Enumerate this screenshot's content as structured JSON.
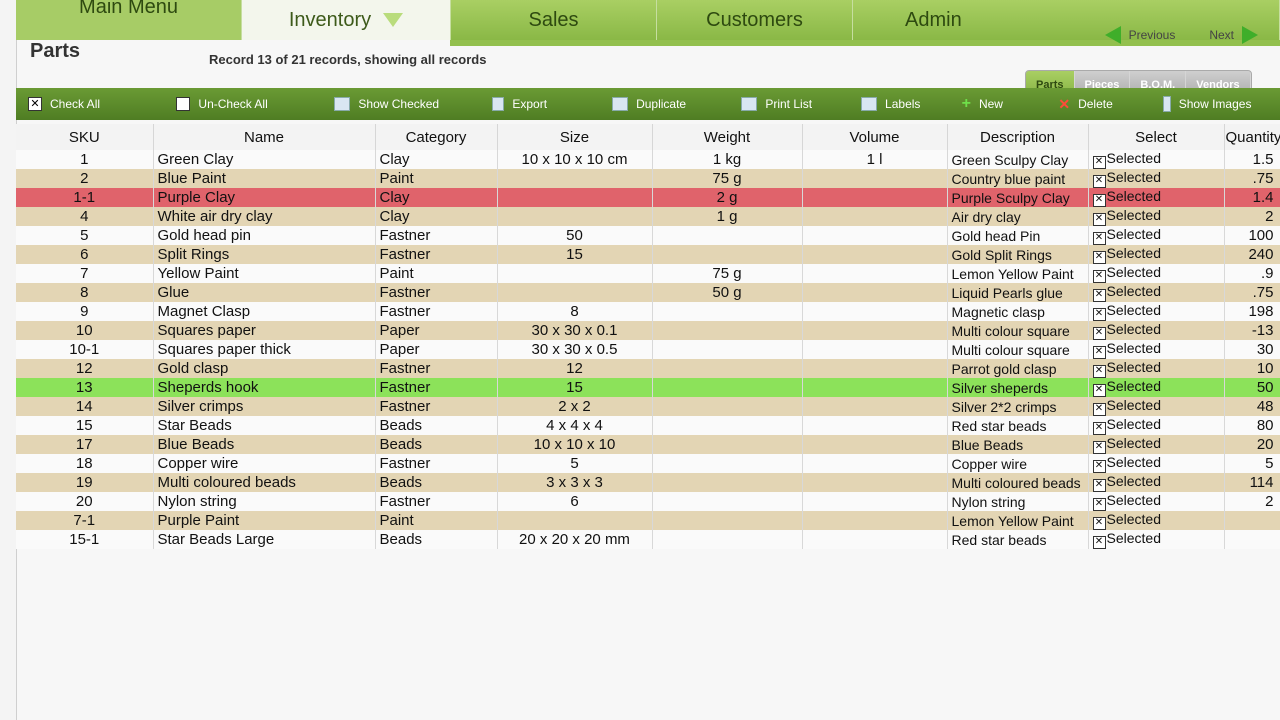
{
  "tabs": [
    {
      "label": "Main Menu"
    },
    {
      "label": "Inventory"
    },
    {
      "label": "Sales"
    },
    {
      "label": "Customers"
    },
    {
      "label": "Admin"
    }
  ],
  "nav": {
    "previous": "Previous",
    "next": "Next"
  },
  "page_title": "Parts",
  "record_info": "Record 13 of 21 records, showing all records",
  "segmented": [
    "Parts",
    "Pieces",
    "B.O.M.",
    "Vendors"
  ],
  "toolbar": {
    "check_all": "Check All",
    "uncheck_all": "Un-Check All",
    "show_checked": "Show Checked",
    "export": "Export",
    "duplicate": "Duplicate",
    "print_list": "Print List",
    "labels": "Labels",
    "new": "New",
    "delete": "Delete",
    "show_images": "Show Images"
  },
  "columns": [
    "SKU",
    "Name",
    "Category",
    "Size",
    "Weight",
    "Volume",
    "Description",
    "Select",
    "Quantity"
  ],
  "rows": [
    {
      "sku": "1",
      "name": "Green Clay",
      "category": "Clay",
      "size": "10 x 10 x 10 cm",
      "weight": "1 kg",
      "volume": "1 l",
      "description": "Green Sculpy Clay",
      "select": "Selected",
      "quantity": "1.5"
    },
    {
      "sku": "2",
      "name": "Blue Paint",
      "category": "Paint",
      "size": "",
      "weight": "75 g",
      "volume": "",
      "description": "Country blue paint",
      "select": "Selected",
      "quantity": ".75"
    },
    {
      "sku": "1-1",
      "name": "Purple Clay",
      "category": "Clay",
      "size": "",
      "weight": "2 g",
      "volume": "",
      "description": "Purple Sculpy Clay",
      "select": "Selected",
      "quantity": "1.4"
    },
    {
      "sku": "4",
      "name": "White air dry clay",
      "category": "Clay",
      "size": "",
      "weight": "1 g",
      "volume": "",
      "description": "Air dry clay",
      "select": "Selected",
      "quantity": "2"
    },
    {
      "sku": "5",
      "name": "Gold head pin",
      "category": "Fastner",
      "size": "50",
      "weight": "",
      "volume": "",
      "description": "Gold head Pin",
      "select": "Selected",
      "quantity": "100"
    },
    {
      "sku": "6",
      "name": "Split Rings",
      "category": "Fastner",
      "size": "15",
      "weight": "",
      "volume": "",
      "description": "Gold Split Rings",
      "select": "Selected",
      "quantity": "240"
    },
    {
      "sku": "7",
      "name": "Yellow Paint",
      "category": "Paint",
      "size": "",
      "weight": "75 g",
      "volume": "",
      "description": "Lemon Yellow Paint",
      "select": "Selected",
      "quantity": ".9"
    },
    {
      "sku": "8",
      "name": "Glue",
      "category": "Fastner",
      "size": "",
      "weight": "50 g",
      "volume": "",
      "description": "Liquid Pearls glue",
      "select": "Selected",
      "quantity": ".75"
    },
    {
      "sku": "9",
      "name": "Magnet Clasp",
      "category": "Fastner",
      "size": "8",
      "weight": "",
      "volume": "",
      "description": "Magnetic clasp",
      "select": "Selected",
      "quantity": "198"
    },
    {
      "sku": "10",
      "name": "Squares paper",
      "category": "Paper",
      "size": "30 x 30 x 0.1",
      "weight": "",
      "volume": "",
      "description": "Multi colour square",
      "select": "Selected",
      "quantity": "-13"
    },
    {
      "sku": "10-1",
      "name": "Squares paper thick",
      "category": "Paper",
      "size": "30 x 30 x 0.5",
      "weight": "",
      "volume": "",
      "description": "Multi colour square",
      "select": "Selected",
      "quantity": "30"
    },
    {
      "sku": "12",
      "name": "Gold clasp",
      "category": "Fastner",
      "size": "12",
      "weight": "",
      "volume": "",
      "description": "Parrot gold clasp",
      "select": "Selected",
      "quantity": "10"
    },
    {
      "sku": "13",
      "name": "Sheperds hook",
      "category": "Fastner",
      "size": "15",
      "weight": "",
      "volume": "",
      "description": "Silver sheperds",
      "select": "Selected",
      "quantity": "50"
    },
    {
      "sku": "14",
      "name": "Silver crimps",
      "category": "Fastner",
      "size": "2 x 2",
      "weight": "",
      "volume": "",
      "description": "Silver 2*2 crimps",
      "select": "Selected",
      "quantity": "48"
    },
    {
      "sku": "15",
      "name": "Star Beads",
      "category": "Beads",
      "size": "4 x 4 x 4",
      "weight": "",
      "volume": "",
      "description": "Red star beads",
      "select": "Selected",
      "quantity": "80"
    },
    {
      "sku": "17",
      "name": "Blue Beads",
      "category": "Beads",
      "size": "10 x 10 x 10",
      "weight": "",
      "volume": "",
      "description": "Blue Beads",
      "select": "Selected",
      "quantity": "20"
    },
    {
      "sku": "18",
      "name": "Copper wire",
      "category": "Fastner",
      "size": "5",
      "weight": "",
      "volume": "",
      "description": "Copper wire",
      "select": "Selected",
      "quantity": "5"
    },
    {
      "sku": "19",
      "name": "Multi coloured beads",
      "category": "Beads",
      "size": "3 x 3 x 3",
      "weight": "",
      "volume": "",
      "description": "Multi coloured beads",
      "select": "Selected",
      "quantity": "114"
    },
    {
      "sku": "20",
      "name": "Nylon string",
      "category": "Fastner",
      "size": "6",
      "weight": "",
      "volume": "",
      "description": "Nylon string",
      "select": "Selected",
      "quantity": "2"
    },
    {
      "sku": "7-1",
      "name": "Purple Paint",
      "category": "Paint",
      "size": "",
      "weight": "",
      "volume": "",
      "description": "Lemon Yellow Paint",
      "select": "Selected",
      "quantity": ""
    },
    {
      "sku": "15-1",
      "name": "Star Beads Large",
      "category": "Beads",
      "size": "20 x 20 x 20 mm",
      "weight": "",
      "volume": "",
      "description": "Red star beads",
      "select": "Selected",
      "quantity": ""
    }
  ],
  "row_highlights": {
    "selected_row_sku": "13",
    "flagged_row_sku": "1-1"
  },
  "colors": {
    "accent_green": "#8ab846",
    "toolbar": "#5a8a2a",
    "stripe": "#e3d5b4",
    "highlight_green": "#8ce25a",
    "highlight_red": "#e0636b"
  }
}
